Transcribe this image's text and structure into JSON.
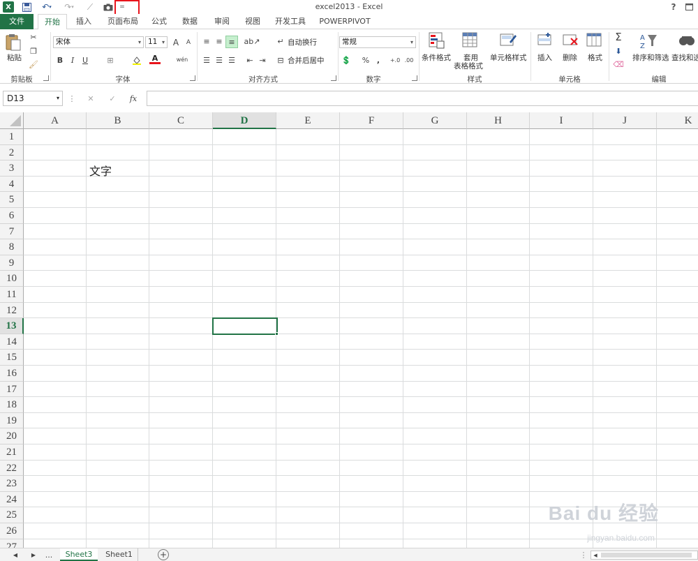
{
  "window": {
    "title": "excel2013 - Excel",
    "help": "?",
    "restore_icon": "restore-icon"
  },
  "qat": {
    "customize": "="
  },
  "tabs": [
    "文件",
    "开始",
    "插入",
    "页面布局",
    "公式",
    "数据",
    "审阅",
    "视图",
    "开发工具",
    "POWERPIVOT"
  ],
  "active_tab": "开始",
  "ribbon": {
    "clipboard": {
      "label": "剪贴板",
      "paste": "粘贴"
    },
    "font": {
      "label": "字体",
      "name": "宋体",
      "size": "11",
      "bold": "B",
      "italic": "I",
      "underline": "U",
      "grow": "A",
      "shrink": "A",
      "color_letter": "A",
      "phonetic": "wén"
    },
    "align": {
      "label": "对齐方式",
      "wrap": "自动换行",
      "merge": "合并后居中"
    },
    "number": {
      "label": "数字",
      "format": "常规",
      "percent": "%",
      "comma": ","
    },
    "styles": {
      "label": "样式",
      "cond": "条件格式",
      "table1": "套用",
      "table2": "表格格式",
      "cell_style": "单元格样式"
    },
    "cells": {
      "label": "单元格",
      "insert": "插入",
      "delete": "删除",
      "format": "格式"
    },
    "editing": {
      "label": "编辑",
      "sort": "排序和筛选",
      "find": "查找和选"
    }
  },
  "formula_bar": {
    "name_box": "D13",
    "fx": "fx",
    "cancel": "✕",
    "enter": "✓",
    "value": ""
  },
  "columns": [
    "A",
    "B",
    "C",
    "D",
    "E",
    "F",
    "G",
    "H",
    "I",
    "J",
    "K"
  ],
  "rows": [
    "1",
    "2",
    "3",
    "4",
    "5",
    "6",
    "7",
    "8",
    "9",
    "10",
    "11",
    "12",
    "13",
    "14",
    "15",
    "16",
    "17",
    "18",
    "19",
    "20",
    "21",
    "22",
    "23",
    "24",
    "25",
    "26",
    "27"
  ],
  "selected": {
    "col": "D",
    "row": "13"
  },
  "cells": {
    "B3": "文字"
  },
  "sheets": [
    "Sheet3",
    "Sheet1"
  ],
  "active_sheet": "Sheet3",
  "sheet_nav": {
    "ellipsis": "...",
    "add": "+"
  },
  "watermark": {
    "brand": "Bai du 经验",
    "url": "jingyan.baidu.com"
  },
  "colors": {
    "accent": "#217346",
    "highlight": "#e8141c"
  }
}
